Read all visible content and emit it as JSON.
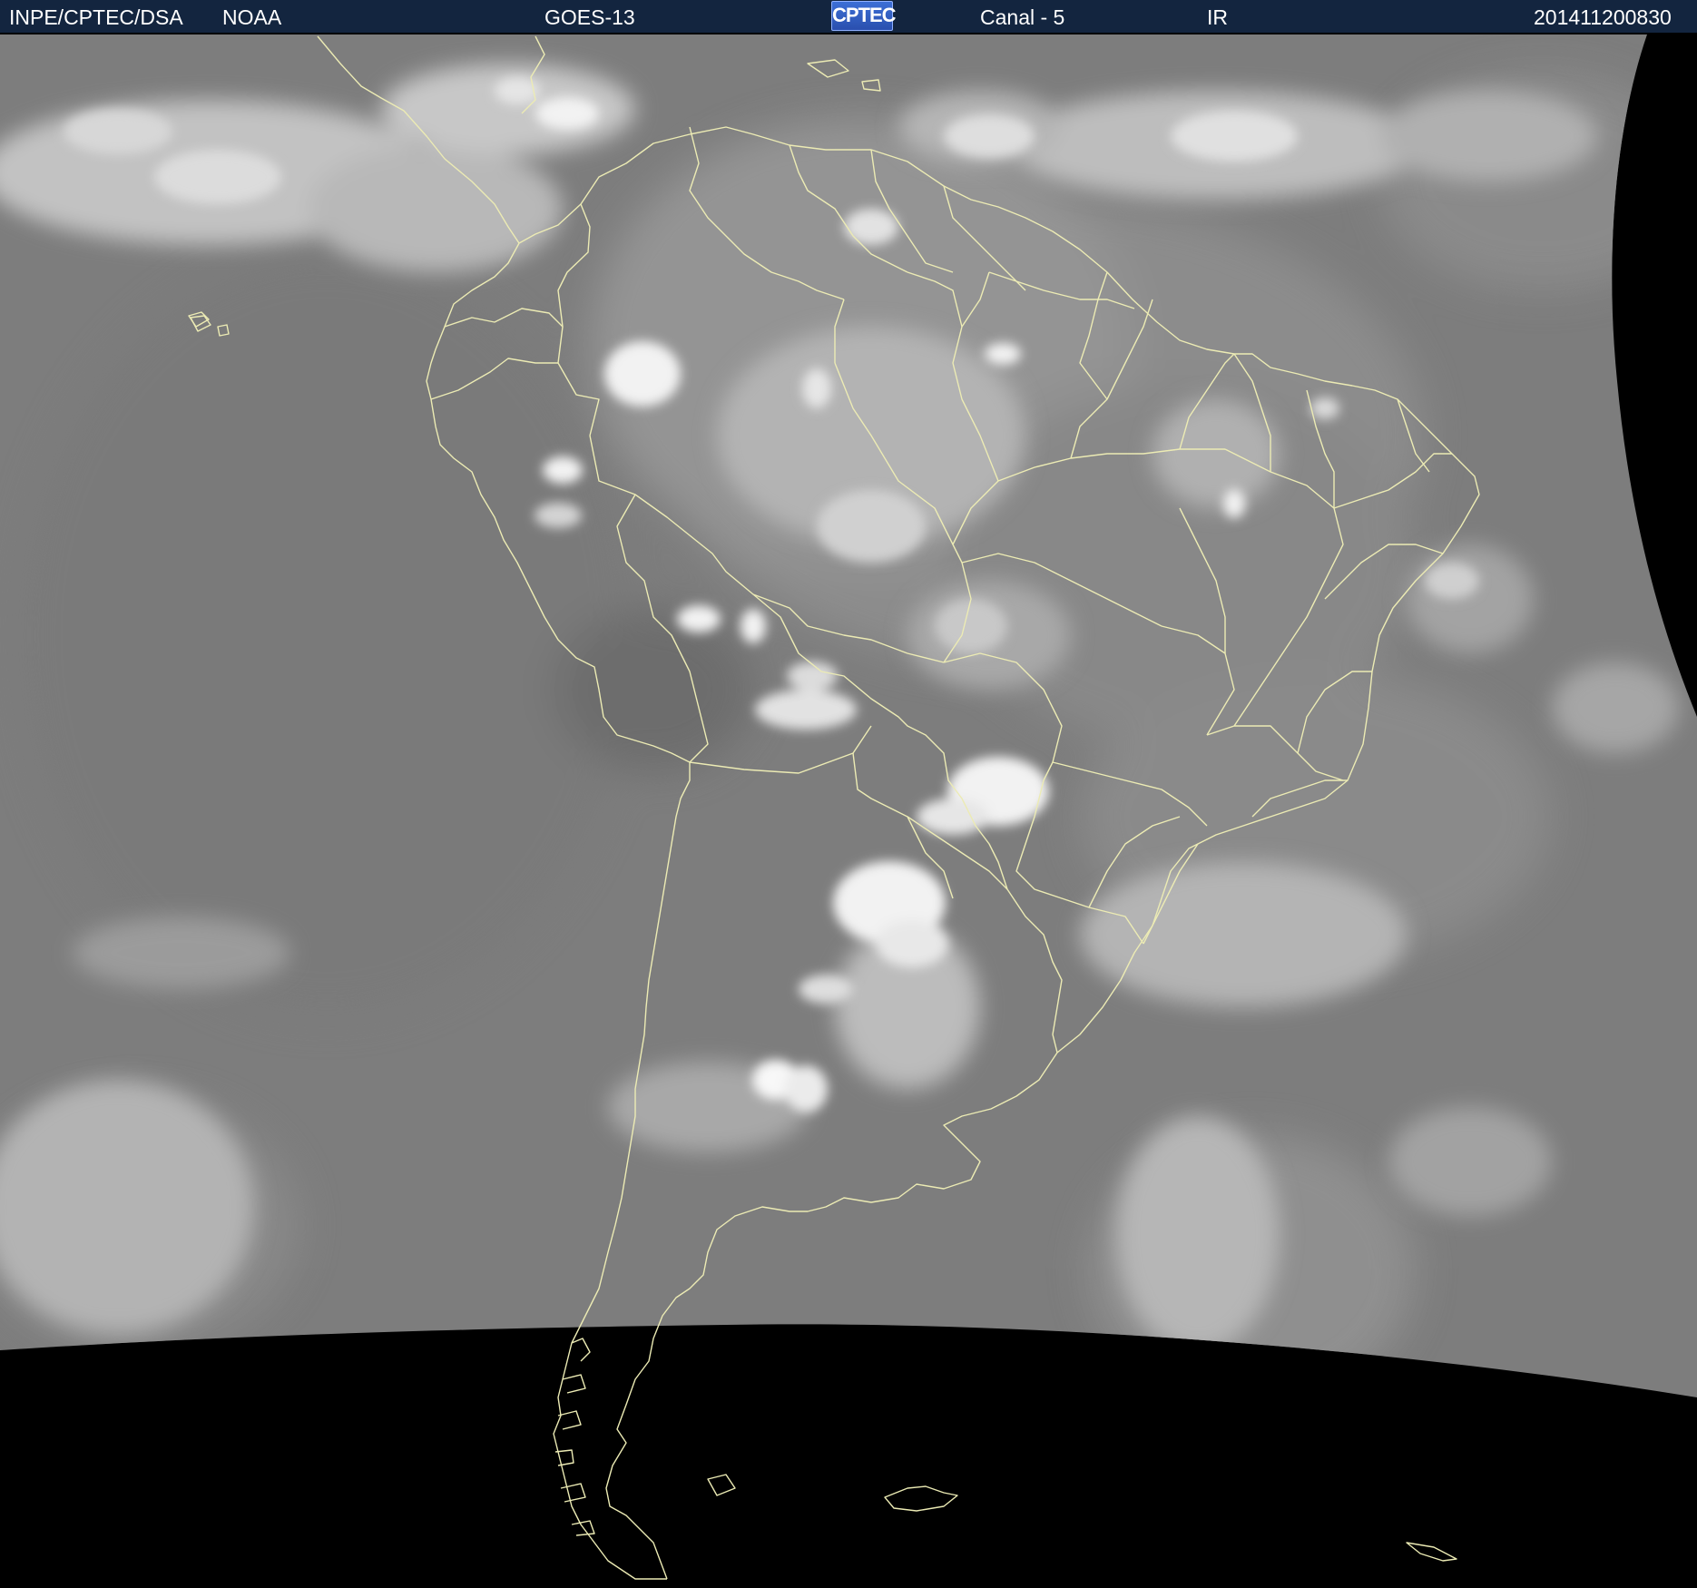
{
  "header": {
    "source": "INPE/CPTEC/DSA",
    "agency": "NOAA",
    "satellite": "GOES-13",
    "logo_text": "CPTEC",
    "channel": "Canal - 5",
    "band": "IR",
    "timestamp": "201411200830"
  },
  "colors": {
    "header_background": "#13253f",
    "header_text": "#ffffff",
    "coastline": "#ecebb4",
    "space_background": "#000000",
    "ocean_cloudfree": "#7e7e7e"
  },
  "image": {
    "type": "infrared satellite image, South America",
    "icon": "cptec-logo"
  }
}
